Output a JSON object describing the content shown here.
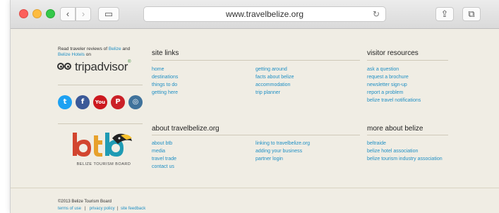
{
  "browser": {
    "url": "www.travelbelize.org",
    "back_glyph": "‹",
    "forward_glyph": "›",
    "sidebar_glyph": "▭",
    "share_glyph": "⇪",
    "tabs_glyph": "⧉",
    "reload_glyph": "↻"
  },
  "tripadvisor": {
    "prefix": "Read traveler reviews of ",
    "link1": "Belize",
    "and": " and",
    "link2": "Belize Hotels",
    "suffix": " on",
    "wordmark": "tripadvisor",
    "reg": "®"
  },
  "social": [
    {
      "name": "twitter-icon",
      "glyph": "t"
    },
    {
      "name": "facebook-icon",
      "glyph": "f"
    },
    {
      "name": "youtube-icon",
      "glyph": "You"
    },
    {
      "name": "pinterest-icon",
      "glyph": "P"
    },
    {
      "name": "instagram-icon",
      "glyph": "◎"
    }
  ],
  "logo": {
    "caption": "BELIZE TOURISM BOARD"
  },
  "site_links": {
    "heading": "site links",
    "col1": [
      "home",
      "destinations",
      "things to do",
      "getting here"
    ],
    "col2": [
      "getting around",
      "facts about belize",
      "accommodation",
      "trip planner"
    ]
  },
  "visitor_resources": {
    "heading": "visitor resources",
    "items": [
      "ask a question",
      "request a brochure",
      "newsletter sign-up",
      "report a problem",
      "belize travel notifications"
    ]
  },
  "about": {
    "heading": "about travelbelize.org",
    "col1": [
      "about btb",
      "media",
      "travel trade",
      "contact us"
    ],
    "col2": [
      "linking to travelbelize.org",
      "adding your business",
      "partner login"
    ]
  },
  "more_about": {
    "heading": "more about belize",
    "items": [
      "beltraide",
      "belize hotel association",
      "belize tourism industry association"
    ]
  },
  "footer": {
    "copyright": "©2013 Belize Tourism Board",
    "links": [
      "terms of use",
      "privacy policy",
      "site feedback"
    ],
    "separator": "|"
  },
  "colors": {
    "link": "#1f8fc4",
    "background": "#f0ede4"
  }
}
